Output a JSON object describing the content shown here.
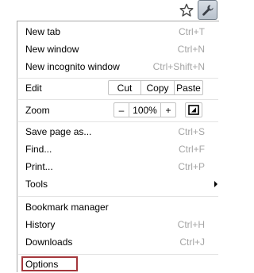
{
  "menu": {
    "new_tab": {
      "label": "New tab",
      "shortcut": "Ctrl+T"
    },
    "new_window": {
      "label": "New window",
      "shortcut": "Ctrl+N"
    },
    "new_incognito": {
      "label": "New incognito window",
      "shortcut": "Ctrl+Shift+N"
    },
    "edit": {
      "label": "Edit",
      "cut": "Cut",
      "copy": "Copy",
      "paste": "Paste"
    },
    "zoom": {
      "label": "Zoom",
      "minus": "–",
      "level": "100%",
      "plus": "+"
    },
    "save_page": {
      "label": "Save page as...",
      "shortcut": "Ctrl+S"
    },
    "find": {
      "label": "Find...",
      "shortcut": "Ctrl+F"
    },
    "print": {
      "label": "Print...",
      "shortcut": "Ctrl+P"
    },
    "tools": {
      "label": "Tools"
    },
    "bookmark_manager": {
      "label": "Bookmark manager"
    },
    "history": {
      "label": "History",
      "shortcut": "Ctrl+H"
    },
    "downloads": {
      "label": "Downloads",
      "shortcut": "Ctrl+J"
    },
    "options": {
      "label": "Options"
    }
  },
  "toolbar": {
    "star_icon": "star-icon",
    "wrench_icon": "wrench-icon"
  },
  "colors": {
    "highlight_box": "#a4373c",
    "shortcut_text": "#a5a5a5",
    "separator": "#e3e3e3"
  }
}
